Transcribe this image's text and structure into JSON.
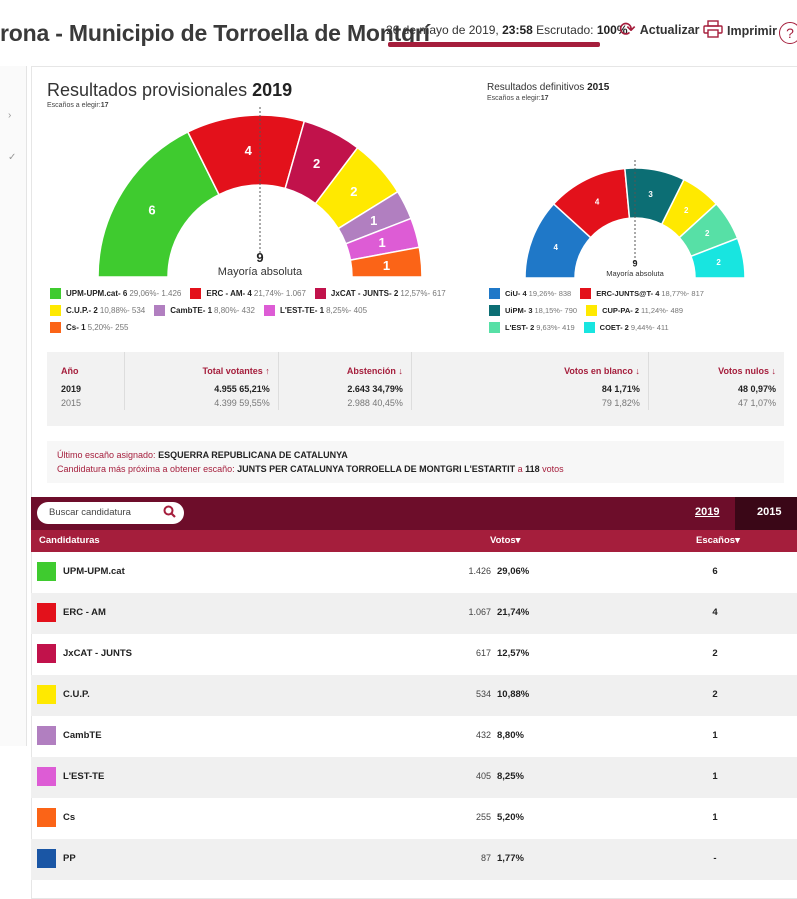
{
  "header": {
    "town_title": "rona - Municipio de Torroella de Montgrí",
    "date_prefix": "26 de mayo de 2019, ",
    "time": "23:58",
    "scrutiny_label": " Escrutado: ",
    "scrutiny_value": "100%",
    "update_label": "Actualizar",
    "print_label": "Imprimir",
    "help": "?"
  },
  "colors": {
    "accent": "#a51e3c",
    "header_dark": "#6d0d2a",
    "header_darker": "#3a0717"
  },
  "chart_data": [
    {
      "type": "pie",
      "subtype": "semicircle-parliament",
      "title": "Resultados provisionales",
      "year": "2019",
      "seats_label": "Escaños a elegir:",
      "seats_total": "17",
      "majority_value": "9",
      "majority_label": "Mayoría absoluta",
      "series": [
        {
          "name": "UPM-UPM.cat",
          "seats": 6,
          "pct": "29,06%",
          "votes": "1.426",
          "color": "#3fcb2f",
          "legend": "UPM-UPM.cat- 6",
          "detail": "29,06%- 1.426"
        },
        {
          "name": "ERC - AM",
          "seats": 4,
          "pct": "21,74%",
          "votes": "1.067",
          "color": "#e3111b",
          "legend": "ERC - AM- 4",
          "detail": "21,74%- 1.067"
        },
        {
          "name": "JxCAT - JUNTS",
          "seats": 2,
          "pct": "12,57%",
          "votes": "617",
          "color": "#c1124b",
          "legend": "JxCAT - JUNTS- 2",
          "detail": "12,57%- 617"
        },
        {
          "name": "C.U.P.",
          "seats": 2,
          "pct": "10,88%",
          "votes": "534",
          "color": "#ffe900",
          "legend": "C.U.P.- 2",
          "detail": "10,88%- 534"
        },
        {
          "name": "CambTE",
          "seats": 1,
          "pct": "8,80%",
          "votes": "432",
          "color": "#b17fc0",
          "legend": "CambTE- 1",
          "detail": "8,80%- 432"
        },
        {
          "name": "L'EST-TE",
          "seats": 1,
          "pct": "8,25%",
          "votes": "405",
          "color": "#dd5cd5",
          "legend": "L'EST-TE- 1",
          "detail": "8,25%- 405"
        },
        {
          "name": "Cs",
          "seats": 1,
          "pct": "5,20%",
          "votes": "255",
          "color": "#fb6417",
          "legend": "Cs- 1",
          "detail": "5,20%- 255"
        }
      ]
    },
    {
      "type": "pie",
      "subtype": "semicircle-parliament",
      "title": "Resultados definitivos",
      "year": "2015",
      "seats_label": "Escaños a elegir:",
      "seats_total": "17",
      "majority_value": "9",
      "majority_label": "Mayoría absoluta",
      "series": [
        {
          "name": "CiU",
          "seats": 4,
          "pct": "19,26%",
          "votes": "838",
          "color": "#1f78c8",
          "legend": "CiU- 4",
          "detail": "19,26%- 838"
        },
        {
          "name": "ERC-JUNTS@T",
          "seats": 4,
          "pct": "18,77%",
          "votes": "817",
          "color": "#e3111b",
          "legend": "ERC-JUNTS@T- 4",
          "detail": "18,77%- 817"
        },
        {
          "name": "UiPM",
          "seats": 3,
          "pct": "18,15%",
          "votes": "790",
          "color": "#0c6e74",
          "legend": "UiPM- 3",
          "detail": "18,15%- 790"
        },
        {
          "name": "CUP-PA",
          "seats": 2,
          "pct": "11,24%",
          "votes": "489",
          "color": "#ffe900",
          "legend": "CUP-PA- 2",
          "detail": "11,24%- 489"
        },
        {
          "name": "L'EST",
          "seats": 2,
          "pct": "9,63%",
          "votes": "419",
          "color": "#57e0a6",
          "legend": "L'EST- 2",
          "detail": "9,63%- 419"
        },
        {
          "name": "COET",
          "seats": 2,
          "pct": "9,44%",
          "votes": "411",
          "color": "#18e5e0",
          "legend": "COET- 2",
          "detail": "9,44%- 411"
        }
      ]
    }
  ],
  "stats": {
    "headers": [
      "Año",
      "Total votantes ↑",
      "Abstención ↓",
      "Votos en blanco ↓",
      "Votos nulos ↓"
    ],
    "rows": [
      {
        "year": "2019",
        "total": "4.955",
        "total_pct": "65,21%",
        "abst": "2.643",
        "abst_pct": "34,79%",
        "blank": "84",
        "blank_pct": "1,71%",
        "null": "48",
        "null_pct": "0,97%"
      },
      {
        "year": "2015",
        "total": "4.399",
        "total_pct": "59,55%",
        "abst": "2.988",
        "abst_pct": "40,45%",
        "blank": "79",
        "blank_pct": "1,82%",
        "null": "47",
        "null_pct": "1,07%"
      }
    ]
  },
  "info": {
    "last_seat_label": "Último escaño asignado: ",
    "last_seat_value": "ESQUERRA REPUBLICANA DE CATALUNYA",
    "next_label": "Candidatura más próxima a obtener escaño: ",
    "next_value": "JUNTS PER CATALUNYA TORROELLA DE MONTGRI L'ESTARTIT",
    "next_a": " a ",
    "next_votes": "118",
    "next_votes_suffix": " votos"
  },
  "table": {
    "search_placeholder": "Buscar candidatura",
    "year_2019": "2019",
    "year_2015": "2015",
    "col_candidaturas": "Candidaturas",
    "col_votos": "Votos▾",
    "col_escanos": "Escaños▾",
    "rows": [
      {
        "name": "UPM-UPM.cat",
        "votes": "1.426",
        "pct": "29,06%",
        "seats": "6",
        "color": "#3fcb2f"
      },
      {
        "name": "ERC - AM",
        "votes": "1.067",
        "pct": "21,74%",
        "seats": "4",
        "color": "#e3111b"
      },
      {
        "name": "JxCAT - JUNTS",
        "votes": "617",
        "pct": "12,57%",
        "seats": "2",
        "color": "#c1124b"
      },
      {
        "name": "C.U.P.",
        "votes": "534",
        "pct": "10,88%",
        "seats": "2",
        "color": "#ffe900"
      },
      {
        "name": "CambTE",
        "votes": "432",
        "pct": "8,80%",
        "seats": "1",
        "color": "#b17fc0"
      },
      {
        "name": "L'EST-TE",
        "votes": "405",
        "pct": "8,25%",
        "seats": "1",
        "color": "#dd5cd5"
      },
      {
        "name": "Cs",
        "votes": "255",
        "pct": "5,20%",
        "seats": "1",
        "color": "#fb6417"
      },
      {
        "name": "PP",
        "votes": "87",
        "pct": "1,77%",
        "seats": "-",
        "color": "#1a56a5"
      }
    ]
  }
}
